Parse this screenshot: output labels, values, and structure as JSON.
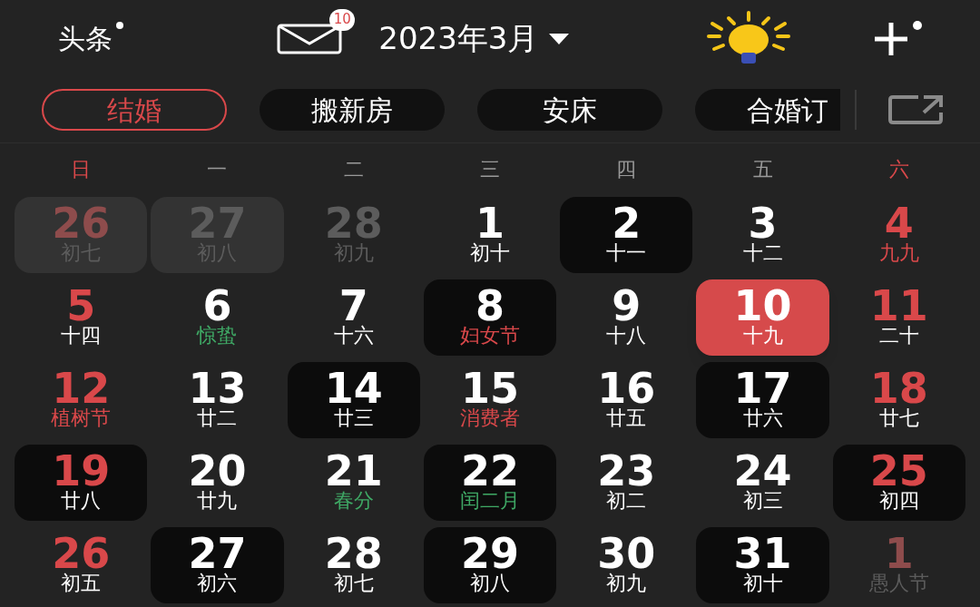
{
  "header": {
    "headlines": "头条",
    "headlines_dot": true,
    "mail_badge": "10",
    "month": "2023年3月",
    "add_dot": true
  },
  "tabs": [
    {
      "label": "结婚",
      "selected": true
    },
    {
      "label": "搬新房",
      "selected": false
    },
    {
      "label": "安床",
      "selected": false
    },
    {
      "label": "合婚订",
      "selected": false
    }
  ],
  "weekdays": [
    {
      "label": "日",
      "weekend": true
    },
    {
      "label": "一",
      "weekend": false
    },
    {
      "label": "二",
      "weekend": false
    },
    {
      "label": "三",
      "weekend": false
    },
    {
      "label": "四",
      "weekend": false
    },
    {
      "label": "五",
      "weekend": false
    },
    {
      "label": "六",
      "weekend": true
    }
  ],
  "days": [
    {
      "day": "26",
      "sub": "初七",
      "kind": "other",
      "color": "#5c5c5c",
      "marked": true,
      "selected": false
    },
    {
      "day": "27",
      "sub": "初八",
      "kind": "other",
      "color": "#5c5c5c",
      "marked": true,
      "selected": false
    },
    {
      "day": "28",
      "sub": "初九",
      "kind": "other",
      "color": "#5c5c5c",
      "marked": false,
      "selected": false
    },
    {
      "day": "1",
      "sub": "初十",
      "kind": "current",
      "color": "#ffffff",
      "marked": false,
      "selected": false
    },
    {
      "day": "2",
      "sub": "十一",
      "kind": "current",
      "color": "#ffffff",
      "marked": true,
      "selected": false
    },
    {
      "day": "3",
      "sub": "十二",
      "kind": "current",
      "color": "#ffffff",
      "marked": false,
      "selected": false
    },
    {
      "day": "4",
      "sub": "九九",
      "kind": "current",
      "color": "#d9484a",
      "marked": false,
      "selected": false
    },
    {
      "day": "5",
      "sub": "十四",
      "kind": "current",
      "color": "#ffffff",
      "marked": false,
      "selected": false
    },
    {
      "day": "6",
      "sub": "惊蛰",
      "kind": "current",
      "color": "#3fa965",
      "marked": false,
      "selected": false
    },
    {
      "day": "7",
      "sub": "十六",
      "kind": "current",
      "color": "#ffffff",
      "marked": false,
      "selected": false
    },
    {
      "day": "8",
      "sub": "妇女节",
      "kind": "current",
      "color": "#d9484a",
      "marked": true,
      "selected": false
    },
    {
      "day": "9",
      "sub": "十八",
      "kind": "current",
      "color": "#ffffff",
      "marked": false,
      "selected": false
    },
    {
      "day": "10",
      "sub": "十九",
      "kind": "current",
      "color": "#ffffff",
      "marked": false,
      "selected": true
    },
    {
      "day": "11",
      "sub": "二十",
      "kind": "current",
      "color": "#ffffff",
      "marked": false,
      "selected": false
    },
    {
      "day": "12",
      "sub": "植树节",
      "kind": "current",
      "color": "#d9484a",
      "marked": false,
      "selected": false
    },
    {
      "day": "13",
      "sub": "廿二",
      "kind": "current",
      "color": "#ffffff",
      "marked": false,
      "selected": false
    },
    {
      "day": "14",
      "sub": "廿三",
      "kind": "current",
      "color": "#ffffff",
      "marked": true,
      "selected": false
    },
    {
      "day": "15",
      "sub": "消费者",
      "kind": "current",
      "color": "#d9484a",
      "marked": false,
      "selected": false
    },
    {
      "day": "16",
      "sub": "廿五",
      "kind": "current",
      "color": "#ffffff",
      "marked": false,
      "selected": false
    },
    {
      "day": "17",
      "sub": "廿六",
      "kind": "current",
      "color": "#ffffff",
      "marked": true,
      "selected": false
    },
    {
      "day": "18",
      "sub": "廿七",
      "kind": "current",
      "color": "#ffffff",
      "marked": false,
      "selected": false
    },
    {
      "day": "19",
      "sub": "廿八",
      "kind": "current",
      "color": "#ffffff",
      "marked": true,
      "selected": false
    },
    {
      "day": "20",
      "sub": "廿九",
      "kind": "current",
      "color": "#ffffff",
      "marked": false,
      "selected": false
    },
    {
      "day": "21",
      "sub": "春分",
      "kind": "current",
      "color": "#3fa965",
      "marked": false,
      "selected": false
    },
    {
      "day": "22",
      "sub": "闰二月",
      "kind": "current",
      "color": "#3fa965",
      "marked": true,
      "selected": false
    },
    {
      "day": "23",
      "sub": "初二",
      "kind": "current",
      "color": "#ffffff",
      "marked": false,
      "selected": false
    },
    {
      "day": "24",
      "sub": "初三",
      "kind": "current",
      "color": "#ffffff",
      "marked": false,
      "selected": false
    },
    {
      "day": "25",
      "sub": "初四",
      "kind": "current",
      "color": "#ffffff",
      "marked": true,
      "selected": false
    },
    {
      "day": "26",
      "sub": "初五",
      "kind": "current",
      "color": "#ffffff",
      "marked": false,
      "selected": false
    },
    {
      "day": "27",
      "sub": "初六",
      "kind": "current",
      "color": "#ffffff",
      "marked": true,
      "selected": false
    },
    {
      "day": "28",
      "sub": "初七",
      "kind": "current",
      "color": "#ffffff",
      "marked": false,
      "selected": false
    },
    {
      "day": "29",
      "sub": "初八",
      "kind": "current",
      "color": "#ffffff",
      "marked": true,
      "selected": false
    },
    {
      "day": "30",
      "sub": "初九",
      "kind": "current",
      "color": "#ffffff",
      "marked": false,
      "selected": false
    },
    {
      "day": "31",
      "sub": "初十",
      "kind": "current",
      "color": "#ffffff",
      "marked": true,
      "selected": false
    },
    {
      "day": "1",
      "sub": "愚人节",
      "kind": "other",
      "color": "#5c5c5c",
      "marked": false,
      "selected": false
    }
  ]
}
